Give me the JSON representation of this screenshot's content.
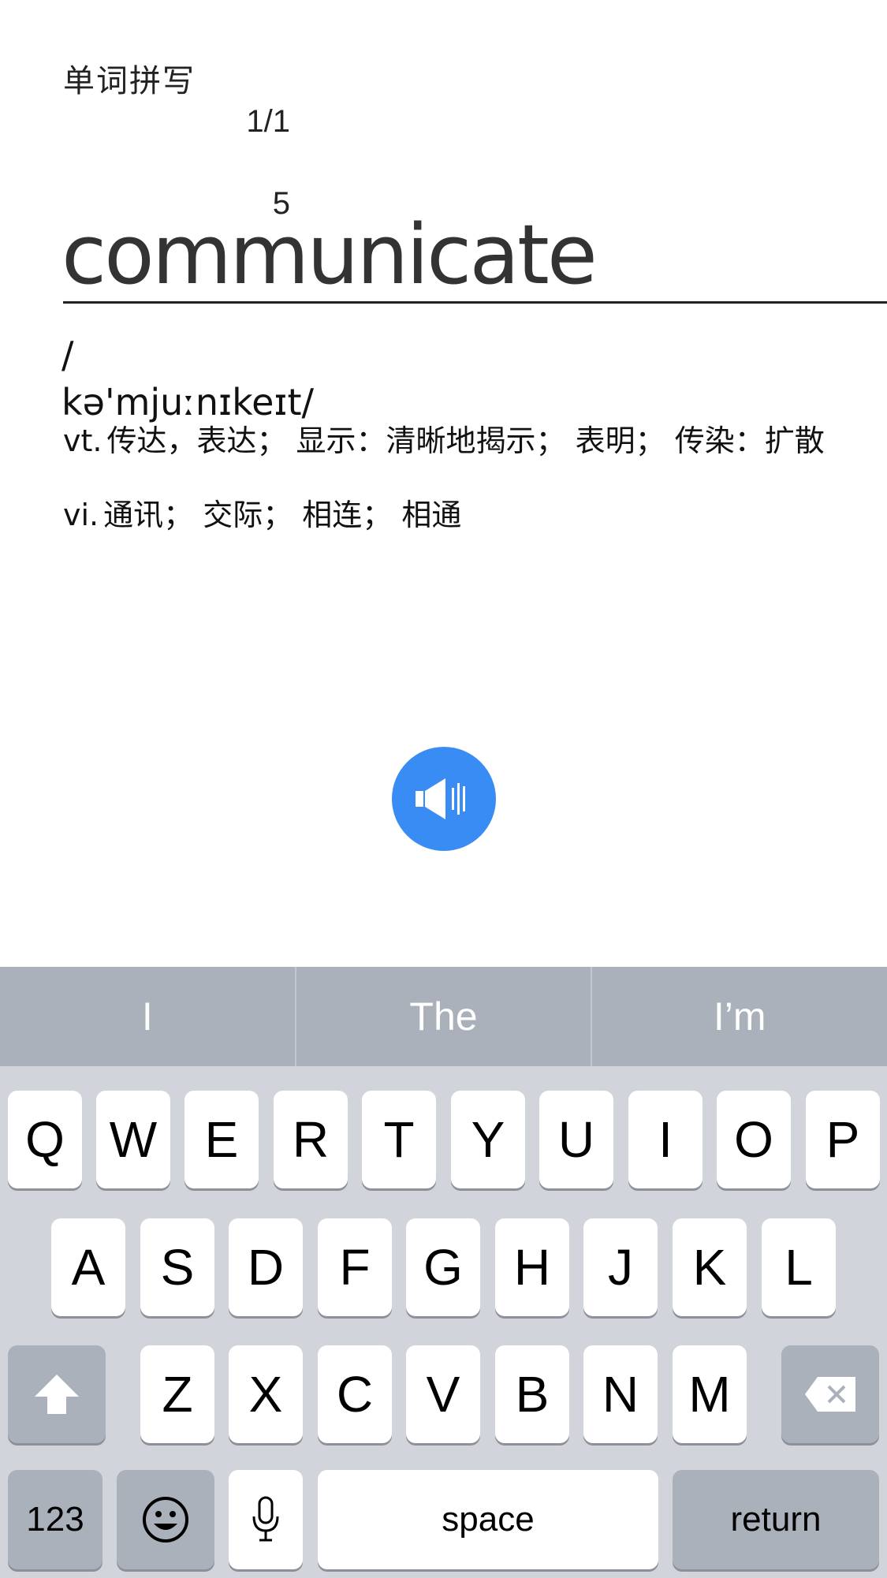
{
  "header": {
    "title": "单词拼写",
    "counter_line1": "1/1",
    "counter_line2": "5"
  },
  "word": {
    "text": "communicate",
    "phonetic_slash": "/",
    "phonetic": "kə'mjuːnɪkeɪt/"
  },
  "definitions": [
    {
      "pos": "vt.",
      "meaning": "传达，表达； 显示：清晰地揭示； 表明； 传染：扩散"
    },
    {
      "pos": "vi.",
      "meaning": "通讯； 交际； 相连； 相通"
    }
  ],
  "speaker": {
    "icon": "speaker-icon",
    "color": "#3a8cf5"
  },
  "keyboard": {
    "suggestions": [
      "I",
      "The",
      "I’m"
    ],
    "row1": [
      "Q",
      "W",
      "E",
      "R",
      "T",
      "Y",
      "U",
      "I",
      "O",
      "P"
    ],
    "row2": [
      "A",
      "S",
      "D",
      "F",
      "G",
      "H",
      "J",
      "K",
      "L"
    ],
    "row3": [
      "Z",
      "X",
      "C",
      "V",
      "B",
      "N",
      "M"
    ],
    "shift_icon": "shift-arrow-icon",
    "backspace_icon": "backspace-icon",
    "numbers_label": "123",
    "emoji_icon": "emoji-icon",
    "mic_icon": "microphone-icon",
    "space_label": "space",
    "return_label": "return"
  }
}
